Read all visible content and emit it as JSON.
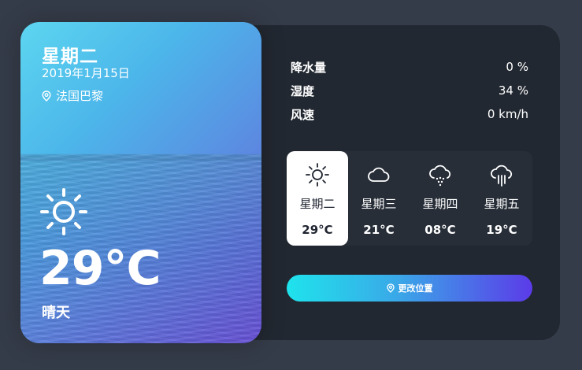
{
  "hero": {
    "day": "星期二",
    "date": "2019年1月15日",
    "location": "法国巴黎",
    "location_icon": "map-pin-icon",
    "weather_icon": "sun-icon",
    "temperature": "29°C",
    "condition": "晴天"
  },
  "stats": [
    {
      "label": "降水量",
      "value": "0 %"
    },
    {
      "label": "湿度",
      "value": "34 %"
    },
    {
      "label": "风速",
      "value": "0 km/h"
    }
  ],
  "forecast": [
    {
      "day": "星期二",
      "temp": "29°C",
      "icon": "sun-icon",
      "active": true
    },
    {
      "day": "星期三",
      "temp": "21°C",
      "icon": "cloud-icon",
      "active": false
    },
    {
      "day": "星期四",
      "temp": "08°C",
      "icon": "snow-cloud-icon",
      "active": false
    },
    {
      "day": "星期五",
      "temp": "19°C",
      "icon": "rain-cloud-icon",
      "active": false
    }
  ],
  "button": {
    "label": "更改位置",
    "icon": "map-pin-icon"
  },
  "colors": {
    "background": "#353c49",
    "panel": "#222831",
    "accent_start": "#1fe3ec",
    "accent_end": "#5b3be8"
  }
}
